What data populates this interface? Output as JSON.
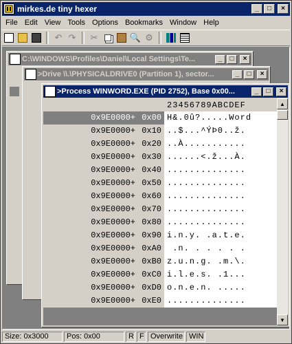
{
  "app": {
    "title": "mirkes.de tiny hexer"
  },
  "menu": [
    "File",
    "Edit",
    "View",
    "Tools",
    "Options",
    "Bookmarks",
    "Window",
    "Help"
  ],
  "toolbar": [
    "new-icon",
    "open-icon",
    "save-icon",
    "undo-icon",
    "redo-icon",
    "cut-icon",
    "copy-icon",
    "paste-icon",
    "find-icon",
    "replace-icon",
    "stats-icon",
    "list-icon"
  ],
  "windows": {
    "file": {
      "title": "C:\\WINDOWS\\Profiles\\Daniel\\Local Settings\\Te..."
    },
    "drive": {
      "title": ">Drive \\\\.\\PHYSICALDRIVE0 (Partition 1), sector..."
    },
    "process": {
      "title": ">Process WINWORD.EXE (PID 2752), Base 0x00..."
    }
  },
  "hex": {
    "header": "23456789ABCDEF",
    "rows": [
      {
        "addr": "0x9E0000+",
        "off": "0x00",
        "ascii": "H&.0û?.....Word",
        "selected": true
      },
      {
        "addr": "0x9E0000+",
        "off": "0x10",
        "ascii": "..$...^ÝÞ0..ž."
      },
      {
        "addr": "0x9E0000+",
        "off": "0x20",
        "ascii": "..À..........."
      },
      {
        "addr": "0x9E0000+",
        "off": "0x30",
        "ascii": "......<.ž...À."
      },
      {
        "addr": "0x9E0000+",
        "off": "0x40",
        "ascii": ".............."
      },
      {
        "addr": "0x9E0000+",
        "off": "0x50",
        "ascii": ".............."
      },
      {
        "addr": "0x9E0000+",
        "off": "0x60",
        "ascii": ".............."
      },
      {
        "addr": "0x9E0000+",
        "off": "0x70",
        "ascii": ".............."
      },
      {
        "addr": "0x9E0000+",
        "off": "0x80",
        "ascii": ".............."
      },
      {
        "addr": "0x9E0000+",
        "off": "0x90",
        "ascii": "i.n.y. .a.t.e."
      },
      {
        "addr": "0x9E0000+",
        "off": "0xA0",
        "ascii": " .n. . . . . ."
      },
      {
        "addr": "0x9E0000+",
        "off": "0xB0",
        "ascii": "z.u.n.g. .m.\\."
      },
      {
        "addr": "0x9E0000+",
        "off": "0xC0",
        "ascii": "i.l.e.s. .1..."
      },
      {
        "addr": "0x9E0000+",
        "off": "0xD0",
        "ascii": "o.n.e.n. ....."
      },
      {
        "addr": "0x9E0000+",
        "off": "0xE0",
        "ascii": ".............."
      }
    ]
  },
  "status": {
    "size": "Size: 0x3000",
    "pos": "Pos: 0x00",
    "r": "R",
    "f": "F",
    "mode": "Overwrite",
    "os": "WIN"
  }
}
